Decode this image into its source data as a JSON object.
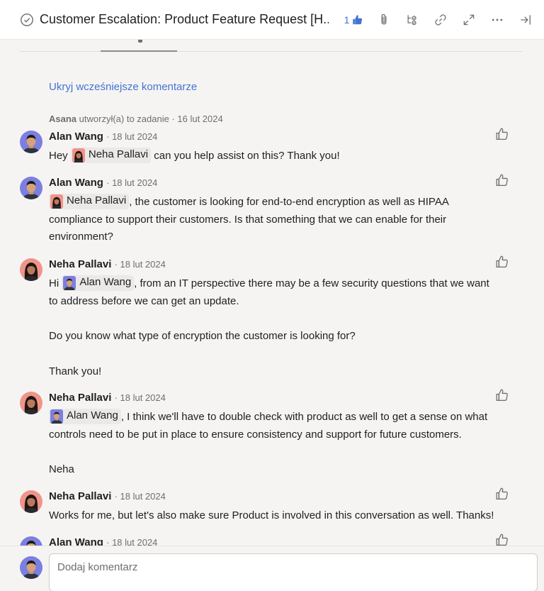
{
  "header": {
    "title": "Customer Escalation: Product Feature Request [H...",
    "like_count": "1",
    "icons": [
      "check-circle-icon",
      "thumbs-up-icon",
      "paperclip-icon",
      "subtask-icon",
      "link-icon",
      "expand-icon",
      "more-icon",
      "close-panel-icon"
    ]
  },
  "feed": {
    "hide_earlier": "Ukryj wcześniejsze komentarze",
    "story": {
      "actor": "Asana",
      "text": "utworzył(a) to zadanie · 16 lut 2024"
    }
  },
  "comments": [
    {
      "author": "Alan Wang",
      "date": "· 18 lut 2024",
      "pre": "Hey",
      "mention": "Neha Pallavi",
      "post": "can you help assist on this? Thank you!"
    },
    {
      "author": "Alan Wang",
      "date": "· 18 lut 2024",
      "mention": "Neha Pallavi",
      "line1": ", the customer is looking for end-to-end encryption as well as HIPAA",
      "line2": "compliance to support their customers. Is that something that we can enable for their",
      "line3": "environment?"
    },
    {
      "author": "Neha Pallavi",
      "date": "· 18 lut 2024",
      "pre": "Hi",
      "mention": "Alan Wang",
      "line1": ", from an IT perspective there may be a few security questions that we want",
      "line2": "to address before we can get an update.",
      "para2": "Do you know what type of encryption the customer is looking for?",
      "para3": "Thank you!"
    },
    {
      "author": "Neha Pallavi",
      "date": "· 18 lut 2024",
      "mention": "Alan Wang",
      "line1": ", I think we'll have to double check with product as well to get a sense on what",
      "line2": "controls need to be put in place to ensure consistency and support for future customers.",
      "para2": "Neha"
    },
    {
      "author": "Neha Pallavi",
      "date": "· 18 lut 2024",
      "line1": "Works for me, but let's also make sure Product is involved in this conversation as well. Thanks!"
    },
    {
      "author": "Alan Wang",
      "date": "· 18 lut 2024"
    }
  ],
  "composer": {
    "placeholder": "Dodaj komentarz"
  },
  "colors": {
    "accent": "#4573d2",
    "background": "#f5f4f3",
    "mention_bg": "#ebe9e7"
  }
}
